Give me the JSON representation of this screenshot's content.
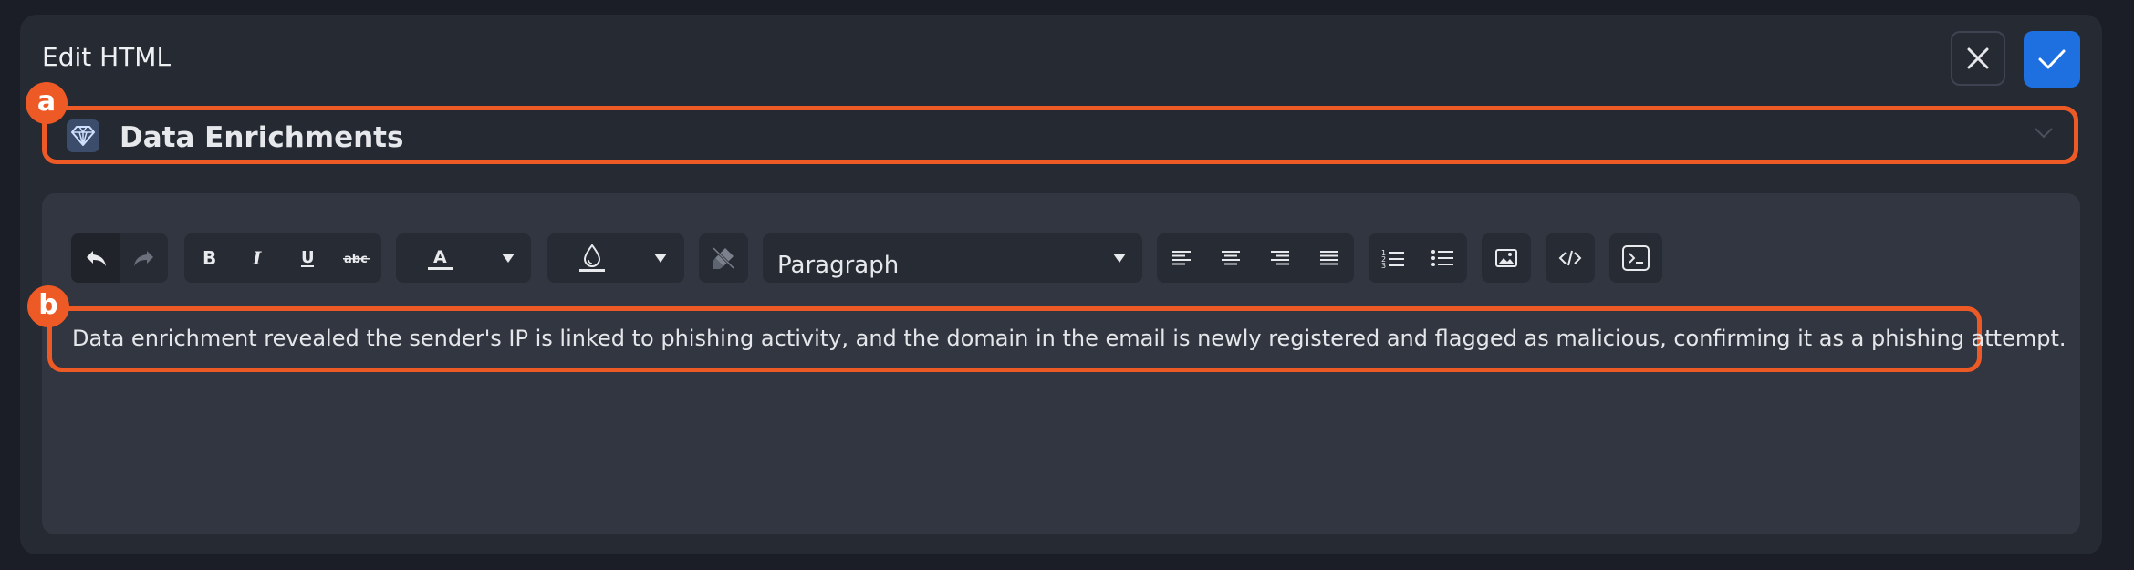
{
  "dialog": {
    "title": "Edit HTML",
    "close_icon": "close-icon",
    "confirm_icon": "check-icon"
  },
  "section_select": {
    "icon": "diamond-icon",
    "label": "Data Enrichments",
    "chevron_icon": "chevron-down-icon"
  },
  "toolbar": {
    "undo_icon": "undo-icon",
    "redo_icon": "redo-icon",
    "bold_icon": "bold-icon",
    "italic_icon": "italic-icon",
    "underline_icon": "underline-icon",
    "strikethrough_icon": "strikethrough-icon",
    "font_color_icon": "font-color-icon",
    "highlight_color_icon": "highlight-color-icon",
    "clear_format_icon": "clear-format-icon",
    "block_format": "Paragraph",
    "align_icons": [
      "align-left-icon",
      "align-center-icon",
      "align-right-icon",
      "align-justify-icon"
    ],
    "list_icons": [
      "numbered-list-icon",
      "bulleted-list-icon"
    ],
    "image_icon": "image-icon",
    "code_icon": "code-icon",
    "source_icon": "terminal-icon"
  },
  "editor": {
    "content": "Data enrichment revealed the sender's IP is linked to phishing activity, and the domain in the email is newly registered and flagged as malicious, confirming it as a phishing attempt."
  },
  "annotations": {
    "a": "a",
    "b": "b"
  },
  "colors": {
    "accent": "#1e6fe0",
    "highlight": "#ee5a26",
    "panel": "#262a33",
    "editor": "#323640"
  }
}
